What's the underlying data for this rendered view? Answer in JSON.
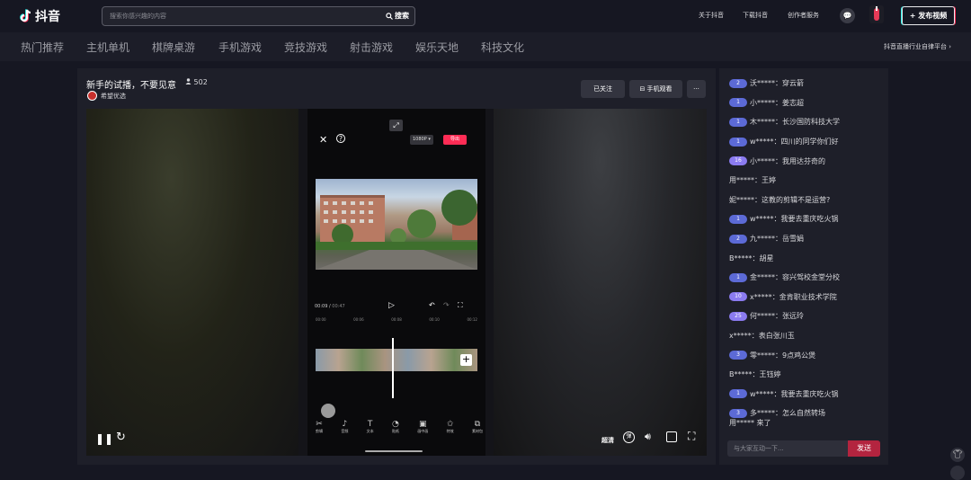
{
  "header": {
    "logo_text": "抖音",
    "search_placeholder": "搜索你感兴趣的内容",
    "search_button": "搜索",
    "links": [
      "关于抖音",
      "下载抖音",
      "创作者服务"
    ],
    "publish_button": "+ 发布视频"
  },
  "categories": [
    "热门推荐",
    "主机单机",
    "棋牌桌游",
    "手机游戏",
    "竞技游戏",
    "射击游戏",
    "娱乐天地",
    "科技文化"
  ],
  "category_right": "抖音直播行业自律平台",
  "room": {
    "title": "新手的试播，不要见意",
    "viewer_count": "502",
    "anchor_name": "希望优选",
    "followed_button": "已关注",
    "phone_watch_button": "手机观看",
    "more_button": "···"
  },
  "editor": {
    "resolution": "1080P",
    "export_button": "导出",
    "time_current": "00:09",
    "time_total": "00:47",
    "ticks": [
      "00:00",
      "00:06",
      "00:08",
      "00:10",
      "00:12"
    ],
    "tools": [
      "剪辑",
      "音频",
      "文本",
      "贴纸",
      "画中画",
      "特效",
      "素材包"
    ]
  },
  "player": {
    "quality": "超清"
  },
  "chat": {
    "messages": [
      {
        "level": "2",
        "user": "沃*****",
        "text": "穿云箭"
      },
      {
        "level": "1",
        "user": "小*****",
        "text": "姜志超"
      },
      {
        "level": "1",
        "user": "木*****",
        "text": "长沙国防科技大学"
      },
      {
        "level": "1",
        "user": "w*****",
        "text": "四川的同学你们好"
      },
      {
        "level": "16",
        "user": "小*****",
        "text": "我用达芬奇的"
      },
      {
        "level": "",
        "user": "用*****",
        "text": "王婷"
      },
      {
        "level": "",
        "user": "妮*****",
        "text": "这教的剪辑不是运营?"
      },
      {
        "level": "1",
        "user": "w*****",
        "text": "我要去重庆吃火锅"
      },
      {
        "level": "2",
        "user": "九*****",
        "text": "岳雪娟"
      },
      {
        "level": "",
        "user": "B*****",
        "text": "胡星"
      },
      {
        "level": "1",
        "user": "金*****",
        "text": "容兴驾校金堂分校"
      },
      {
        "level": "10",
        "user": "x*****",
        "text": "金肯职业技术学院"
      },
      {
        "level": "25",
        "user": "何*****",
        "text": "张远玲"
      },
      {
        "level": "",
        "user": "x*****",
        "text": "表白张川玉"
      },
      {
        "level": "3",
        "user": "零*****",
        "text": "9点鸡公煲"
      },
      {
        "level": "",
        "user": "B*****",
        "text": "王钰婷"
      },
      {
        "level": "1",
        "user": "w*****",
        "text": "我要去重庆吃火锅"
      },
      {
        "level": "3",
        "user": "多*****",
        "text": "怎么自然转场"
      }
    ],
    "join_user": "用*****",
    "join_text": "来了",
    "input_placeholder": "与大家互动一下...",
    "send_button": "发送"
  }
}
